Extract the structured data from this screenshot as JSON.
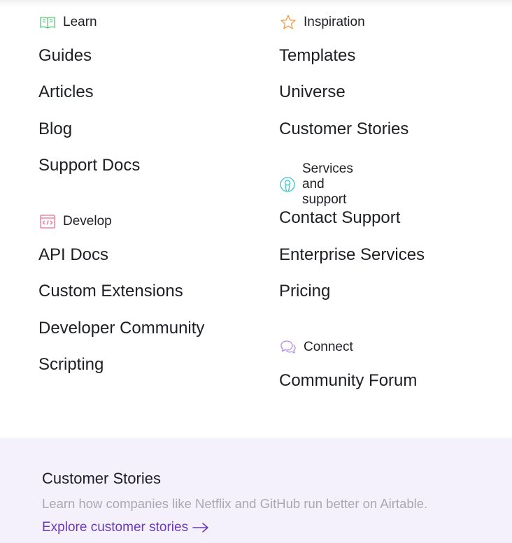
{
  "sections": {
    "learn": {
      "heading": "Learn",
      "icon": "book-icon",
      "icon_color": "#5fbf7a",
      "links": [
        "Guides",
        "Articles",
        "Blog",
        "Support Docs"
      ]
    },
    "develop": {
      "heading": "Develop",
      "icon": "code-icon",
      "icon_color": "#ef6f8f",
      "links": [
        "API Docs",
        "Custom Extensions",
        "Developer Community",
        "Scripting"
      ]
    },
    "inspiration": {
      "heading": "Inspiration",
      "icon": "star-icon",
      "icon_color": "#f2994a",
      "links": [
        "Templates",
        "Universe",
        "Customer Stories"
      ]
    },
    "services": {
      "heading": "Services and support",
      "icon": "person-icon",
      "icon_color": "#3cc5c0",
      "links": [
        "Contact Support",
        "Enterprise Services",
        "Pricing"
      ]
    },
    "connect": {
      "heading": "Connect",
      "icon": "chat-bubbles-icon",
      "icon_color": "#b18ce6",
      "links": [
        "Community Forum"
      ]
    }
  },
  "footer": {
    "title": "Customer Stories",
    "description": "Learn how companies like Netflix and GitHub run better on Airtable.",
    "cta": "Explore customer stories",
    "cta_color": "#6b3ab8",
    "background": "#f4f1fd"
  }
}
